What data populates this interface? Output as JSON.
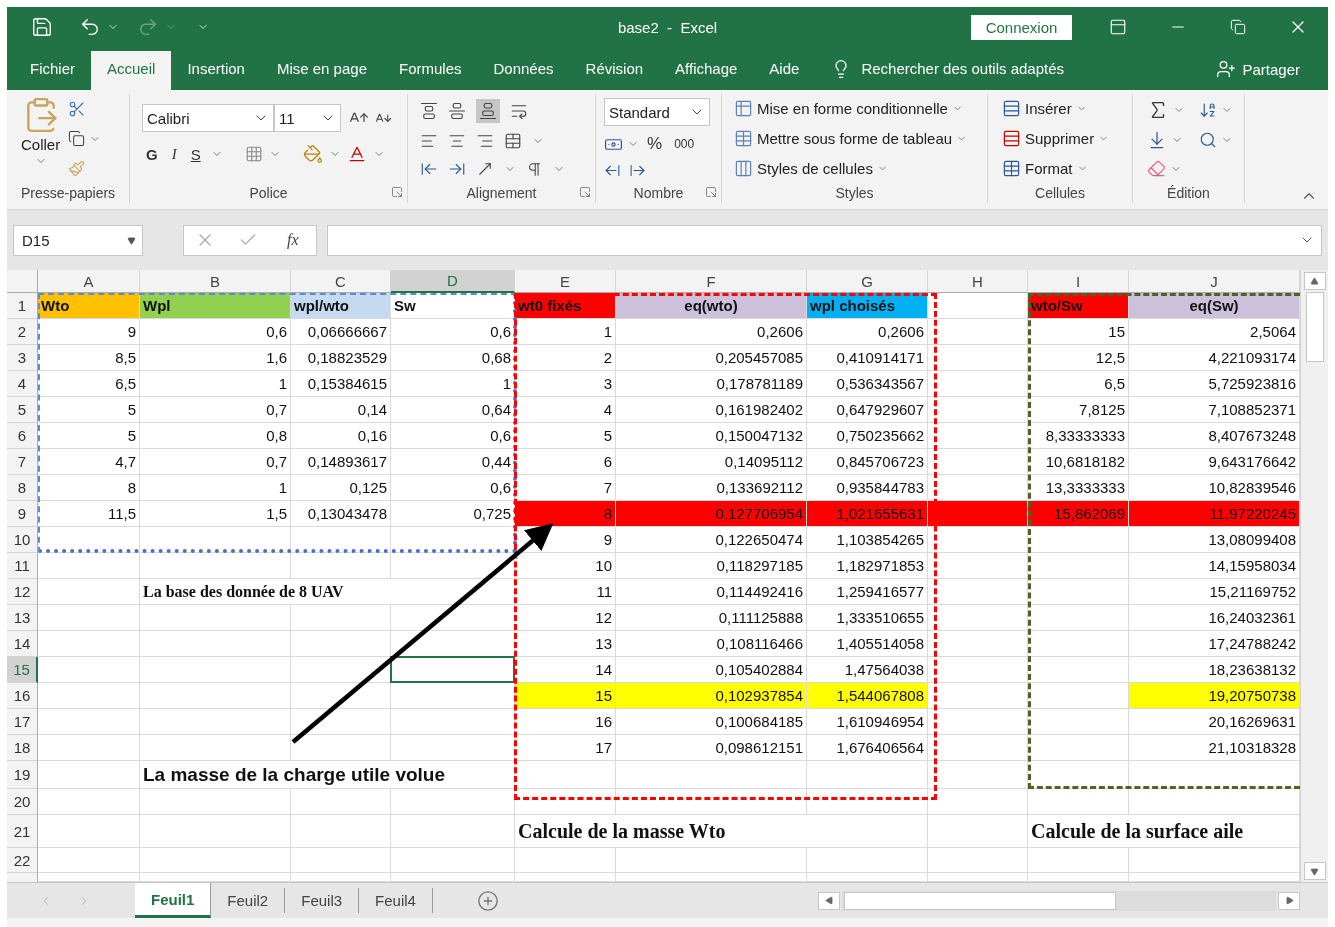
{
  "title_bar": {
    "document_title": "base2  -  Excel",
    "sign_in": "Connexion"
  },
  "menu_tabs": [
    {
      "label": "Fichier",
      "selected": false
    },
    {
      "label": "Accueil",
      "selected": true
    },
    {
      "label": "Insertion",
      "selected": false
    },
    {
      "label": "Mise en page",
      "selected": false
    },
    {
      "label": "Formules",
      "selected": false
    },
    {
      "label": "Données",
      "selected": false
    },
    {
      "label": "Révision",
      "selected": false
    },
    {
      "label": "Affichage",
      "selected": false
    },
    {
      "label": "Aide",
      "selected": false
    }
  ],
  "tell_me": "Rechercher des outils adaptés",
  "share": "Partager",
  "ribbon": {
    "clipboard": {
      "paste": "Coller",
      "label": "Presse-papiers"
    },
    "font": {
      "name": "Calibri",
      "size": "11",
      "bold": "G",
      "italic": "I",
      "underline": "S",
      "label": "Police"
    },
    "alignment": {
      "label": "Alignement"
    },
    "number": {
      "format": "Standard",
      "percent": "%",
      "thousands": "000",
      "label": "Nombre"
    },
    "styles": {
      "items": [
        "Mise en forme conditionnelle",
        "Mettre sous forme de tableau",
        "Styles de cellules"
      ],
      "label": "Styles"
    },
    "cells": {
      "items": [
        "Insérer",
        "Supprimer",
        "Format"
      ],
      "label": "Cellules"
    },
    "editing": {
      "label": "Édition"
    }
  },
  "formula_bar": {
    "name_box": "D15",
    "function_label": "fx"
  },
  "sheet": {
    "columns": [
      {
        "label": "A",
        "selected": false
      },
      {
        "label": "B",
        "selected": false
      },
      {
        "label": "C",
        "selected": false
      },
      {
        "label": "D",
        "selected": true
      },
      {
        "label": "E",
        "selected": false
      },
      {
        "label": "F",
        "selected": false
      },
      {
        "label": "G",
        "selected": false
      },
      {
        "label": "H",
        "selected": false
      },
      {
        "label": "I",
        "selected": false
      },
      {
        "label": "J",
        "selected": false
      }
    ],
    "rows": [
      {
        "number": "1",
        "selected": false,
        "cells": [
          {
            "text": "Wto",
            "kind": "label",
            "color": "#ffc000"
          },
          {
            "text": "Wpl",
            "kind": "label",
            "color": "#92d050"
          },
          {
            "text": "wpl/wto",
            "kind": "label",
            "color": "#c5d9f1"
          },
          {
            "text": "Sw",
            "kind": "label"
          },
          {
            "text": "wt0  fixés",
            "kind": "label",
            "color": "#ff0000"
          },
          {
            "text": "eq(wto)",
            "kind": "centered",
            "color": "#ccc0da"
          },
          {
            "text": "wpl choisés",
            "kind": "label",
            "color": "#00b0f0"
          },
          null,
          {
            "text": "wto/Sw",
            "kind": "label",
            "color": "#ff0000"
          },
          {
            "text": "eq(Sw)",
            "kind": "centered",
            "color": "#ccc0da"
          }
        ]
      },
      {
        "number": "2",
        "selected": false,
        "cells": [
          {
            "text": "9",
            "kind": "value"
          },
          {
            "text": "0,6",
            "kind": "value"
          },
          {
            "text": "0,06666667",
            "kind": "value"
          },
          {
            "text": "0,6",
            "kind": "value"
          },
          {
            "text": "1",
            "kind": "value"
          },
          {
            "text": "0,2606",
            "kind": "value"
          },
          {
            "text": "0,2606",
            "kind": "value"
          },
          null,
          {
            "text": "15",
            "kind": "value"
          },
          {
            "text": "2,5064",
            "kind": "value"
          }
        ]
      },
      {
        "number": "3",
        "selected": false,
        "cells": [
          {
            "text": "8,5",
            "kind": "value"
          },
          {
            "text": "1,6",
            "kind": "value"
          },
          {
            "text": "0,18823529",
            "kind": "value"
          },
          {
            "text": "0,68",
            "kind": "value"
          },
          {
            "text": "2",
            "kind": "value"
          },
          {
            "text": "0,205457085",
            "kind": "value"
          },
          {
            "text": "0,410914171",
            "kind": "value"
          },
          null,
          {
            "text": "12,5",
            "kind": "value"
          },
          {
            "text": "4,221093174",
            "kind": "value"
          }
        ]
      },
      {
        "number": "4",
        "selected": false,
        "cells": [
          {
            "text": "6,5",
            "kind": "value"
          },
          {
            "text": "1",
            "kind": "value"
          },
          {
            "text": "0,15384615",
            "kind": "value"
          },
          {
            "text": "1",
            "kind": "value"
          },
          {
            "text": "3",
            "kind": "value"
          },
          {
            "text": "0,178781189",
            "kind": "value"
          },
          {
            "text": "0,536343567",
            "kind": "value"
          },
          null,
          {
            "text": "6,5",
            "kind": "value"
          },
          {
            "text": "5,725923816",
            "kind": "value"
          }
        ]
      },
      {
        "number": "5",
        "selected": false,
        "cells": [
          {
            "text": "5",
            "kind": "value"
          },
          {
            "text": "0,7",
            "kind": "value"
          },
          {
            "text": "0,14",
            "kind": "value"
          },
          {
            "text": "0,64",
            "kind": "value"
          },
          {
            "text": "4",
            "kind": "value"
          },
          {
            "text": "0,161982402",
            "kind": "value"
          },
          {
            "text": "0,647929607",
            "kind": "value"
          },
          null,
          {
            "text": "7,8125",
            "kind": "value"
          },
          {
            "text": "7,108852371",
            "kind": "value"
          }
        ]
      },
      {
        "number": "6",
        "selected": false,
        "cells": [
          {
            "text": "5",
            "kind": "value"
          },
          {
            "text": "0,8",
            "kind": "value"
          },
          {
            "text": "0,16",
            "kind": "value"
          },
          {
            "text": "0,6",
            "kind": "value"
          },
          {
            "text": "5",
            "kind": "value"
          },
          {
            "text": "0,150047132",
            "kind": "value"
          },
          {
            "text": "0,750235662",
            "kind": "value"
          },
          null,
          {
            "text": "8,33333333",
            "kind": "value"
          },
          {
            "text": "8,407673248",
            "kind": "value"
          }
        ]
      },
      {
        "number": "7",
        "selected": false,
        "cells": [
          {
            "text": "4,7",
            "kind": "value"
          },
          {
            "text": "0,7",
            "kind": "value"
          },
          {
            "text": "0,14893617",
            "kind": "value"
          },
          {
            "text": "0,44",
            "kind": "value"
          },
          {
            "text": "6",
            "kind": "value"
          },
          {
            "text": "0,14095112",
            "kind": "value"
          },
          {
            "text": "0,845706723",
            "kind": "value"
          },
          null,
          {
            "text": "10,6818182",
            "kind": "value"
          },
          {
            "text": "9,643176642",
            "kind": "value"
          }
        ]
      },
      {
        "number": "8",
        "selected": false,
        "cells": [
          {
            "text": "8",
            "kind": "value"
          },
          {
            "text": "1",
            "kind": "value"
          },
          {
            "text": "0,125",
            "kind": "value"
          },
          {
            "text": "0,6",
            "kind": "value"
          },
          {
            "text": "7",
            "kind": "value"
          },
          {
            "text": "0,133692112",
            "kind": "value"
          },
          {
            "text": "0,935844783",
            "kind": "value"
          },
          null,
          {
            "text": "13,3333333",
            "kind": "value"
          },
          {
            "text": "10,82839546",
            "kind": "value"
          }
        ]
      },
      {
        "number": "9",
        "selected": false,
        "cells": [
          {
            "text": "11,5",
            "kind": "value"
          },
          {
            "text": "1,5",
            "kind": "value"
          },
          {
            "text": "0,13043478",
            "kind": "value"
          },
          {
            "text": "0,725",
            "kind": "value"
          },
          {
            "text": "8",
            "kind": "value",
            "color": "#ff0000"
          },
          {
            "text": "0,127706954",
            "kind": "value",
            "color": "#ff0000"
          },
          {
            "text": "1,021655631",
            "kind": "value",
            "color": "#ff0000"
          },
          {
            "color": "#ff0000"
          },
          {
            "text": "15,862069",
            "kind": "value",
            "color": "#ff0000"
          },
          {
            "text": "11,97220245",
            "kind": "value",
            "color": "#ff0000"
          }
        ]
      },
      {
        "number": "10",
        "selected": false,
        "cells": [
          null,
          null,
          null,
          null,
          {
            "text": "9",
            "kind": "value"
          },
          {
            "text": "0,122650474",
            "kind": "value"
          },
          {
            "text": "1,103854265",
            "kind": "value"
          },
          null,
          null,
          {
            "text": "13,08099408",
            "kind": "value"
          }
        ]
      },
      {
        "number": "11",
        "selected": false,
        "cells": [
          null,
          null,
          null,
          null,
          {
            "text": "10",
            "kind": "value"
          },
          {
            "text": "0,118297185",
            "kind": "value"
          },
          {
            "text": "1,182971853",
            "kind": "value"
          },
          null,
          null,
          {
            "text": "14,15958034",
            "kind": "value"
          }
        ]
      },
      {
        "number": "12",
        "selected": false,
        "cells": [
          null,
          {
            "text": "La base des donnée de 8 UAV",
            "kind": "note"
          },
          null,
          null,
          {
            "text": "11",
            "kind": "value"
          },
          {
            "text": "0,114492416",
            "kind": "value"
          },
          {
            "text": "1,259416577",
            "kind": "value"
          },
          null,
          null,
          {
            "text": "15,21169752",
            "kind": "value"
          }
        ]
      },
      {
        "number": "13",
        "selected": false,
        "cells": [
          null,
          null,
          null,
          null,
          {
            "text": "12",
            "kind": "value"
          },
          {
            "text": "0,111125888",
            "kind": "value"
          },
          {
            "text": "1,333510655",
            "kind": "value"
          },
          null,
          null,
          {
            "text": "16,24032361",
            "kind": "value"
          }
        ]
      },
      {
        "number": "14",
        "selected": false,
        "cells": [
          null,
          null,
          null,
          null,
          {
            "text": "13",
            "kind": "value"
          },
          {
            "text": "0,108116466",
            "kind": "value"
          },
          {
            "text": "1,405514058",
            "kind": "value"
          },
          null,
          null,
          {
            "text": "17,24788242",
            "kind": "value"
          }
        ]
      },
      {
        "number": "15",
        "selected": true,
        "cells": [
          null,
          null,
          null,
          null,
          {
            "text": "14",
            "kind": "value"
          },
          {
            "text": "0,105402884",
            "kind": "value"
          },
          {
            "text": "1,47564038",
            "kind": "value"
          },
          null,
          null,
          {
            "text": "18,23638132",
            "kind": "value"
          }
        ]
      },
      {
        "number": "16",
        "selected": false,
        "cells": [
          null,
          null,
          null,
          null,
          {
            "text": "15",
            "kind": "value",
            "color": "#ffff00"
          },
          {
            "text": "0,102937854",
            "kind": "value",
            "color": "#ffff00"
          },
          {
            "text": "1,544067808",
            "kind": "value",
            "color": "#ffff00"
          },
          null,
          null,
          {
            "text": "19,20750738",
            "kind": "value",
            "color": "#ffff00"
          }
        ]
      },
      {
        "number": "17",
        "selected": false,
        "cells": [
          null,
          null,
          null,
          null,
          {
            "text": "16",
            "kind": "value"
          },
          {
            "text": "0,100684185",
            "kind": "value"
          },
          {
            "text": "1,610946954",
            "kind": "value"
          },
          null,
          null,
          {
            "text": "20,16269631",
            "kind": "value"
          }
        ]
      },
      {
        "number": "18",
        "selected": false,
        "cells": [
          null,
          null,
          null,
          null,
          {
            "text": "17",
            "kind": "value"
          },
          {
            "text": "0,098612151",
            "kind": "value"
          },
          {
            "text": "1,676406564",
            "kind": "value"
          },
          null,
          null,
          {
            "text": "21,10318328",
            "kind": "value"
          }
        ]
      },
      {
        "number": "19",
        "selected": false,
        "cells": [
          null,
          {
            "text": "La masse de la charge utile volue",
            "kind": "caption"
          },
          null,
          null,
          null,
          null,
          null,
          null,
          null,
          null
        ]
      },
      {
        "number": "20",
        "selected": false,
        "cells": [
          null,
          null,
          null,
          null,
          null,
          null,
          null,
          null,
          null,
          null
        ]
      },
      {
        "number": "21",
        "selected": false,
        "cells": [
          null,
          null,
          null,
          null,
          {
            "text": "Calcule de la masse Wto",
            "kind": "heading"
          },
          null,
          null,
          null,
          {
            "text": "Calcule de la surface aile",
            "kind": "heading"
          },
          null
        ]
      },
      {
        "number": "22",
        "selected": false,
        "cells": [
          null,
          null,
          null,
          null,
          null,
          null,
          null,
          null,
          null,
          null
        ]
      }
    ]
  },
  "sheet_tabs": [
    {
      "label": "Feuil1",
      "selected": true
    },
    {
      "label": "Feuil2",
      "selected": false
    },
    {
      "label": "Feuil3",
      "selected": false
    },
    {
      "label": "Feuil4",
      "selected": false
    }
  ]
}
